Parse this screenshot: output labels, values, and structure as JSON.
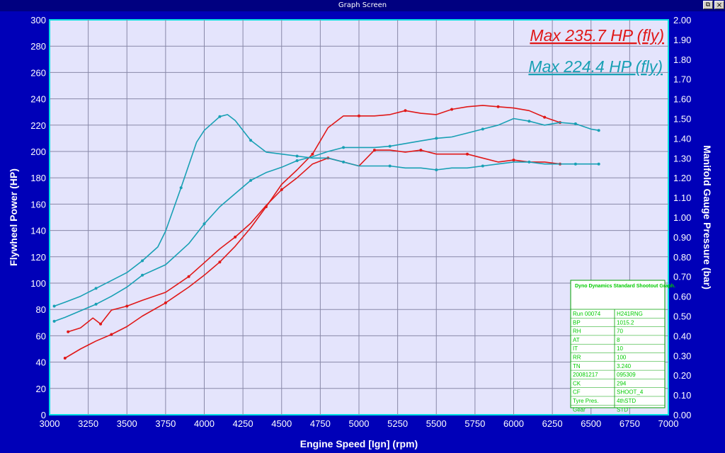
{
  "window": {
    "title": "Graph Screen",
    "restore_label": "⧉",
    "close_label": "×"
  },
  "annotations": {
    "max_red": "Max 235.7 HP (fly)",
    "max_teal": "Max 224.4 HP (fly)"
  },
  "colors": {
    "background": "#0000b8",
    "plot_bg": "#e4e4fc",
    "grid": "#8888a8",
    "axis": "#00e0e0",
    "red": "#e01818",
    "teal": "#18a0b4",
    "info_text": "#00cc00"
  },
  "info_box": {
    "title": "Dyno Dynamics Standard Shootout Graph.",
    "rows": [
      [
        "Run 00074",
        "H241RNG"
      ],
      [
        "BP",
        "1015.2"
      ],
      [
        "RH",
        "70"
      ],
      [
        "AT",
        "8"
      ],
      [
        "IT",
        "10"
      ],
      [
        "RR",
        "100"
      ],
      [
        "TN",
        "3.240"
      ],
      [
        "20081217",
        "095309"
      ],
      [
        "CK",
        "294"
      ],
      [
        "CF",
        "SHOOT_4"
      ],
      [
        "Tyre Pres.",
        "4thSTD"
      ],
      [
        "Gear",
        "STD"
      ]
    ]
  },
  "chart_data": {
    "type": "line",
    "xlabel": "Engine Speed [Ign] (rpm)",
    "ylabel": "Flywheel Power (HP)",
    "y2label": "Manifold Gauge Pressure (bar)",
    "xlim": [
      3000,
      7000
    ],
    "ylim": [
      0,
      300
    ],
    "y2lim": [
      0,
      2.0
    ],
    "xticks": [
      3000,
      3250,
      3500,
      3750,
      4000,
      4250,
      4500,
      4750,
      5000,
      5250,
      5500,
      5750,
      6000,
      6250,
      6500,
      6750,
      7000
    ],
    "yticks": [
      0,
      20,
      40,
      60,
      80,
      100,
      120,
      140,
      160,
      180,
      200,
      220,
      240,
      260,
      280,
      300
    ],
    "y2ticks": [
      "0.00",
      "0.10",
      "0.20",
      "0.30",
      "0.40",
      "0.50",
      "0.60",
      "0.70",
      "0.80",
      "0.90",
      "1.00",
      "1.10",
      "1.20",
      "1.30",
      "1.40",
      "1.50",
      "1.60",
      "1.70",
      "1.80",
      "1.90",
      "2.00"
    ],
    "grid": true,
    "series": [
      {
        "color": "#e01818",
        "axis": "left",
        "x": [
          3100,
          3200,
          3300,
          3400,
          3500,
          3600,
          3750,
          3900,
          4000,
          4100,
          4200,
          4300,
          4400,
          4500,
          4600,
          4700,
          4800,
          4900,
          5000,
          5100,
          5200,
          5300,
          5400,
          5500,
          5600,
          5700,
          5800,
          5900,
          6000,
          6100,
          6200,
          6300
        ],
        "y": [
          43,
          50,
          56,
          61,
          67,
          75,
          85,
          97,
          106,
          116,
          128,
          142,
          158,
          175,
          186,
          198,
          218,
          227,
          227,
          227,
          228,
          231,
          229,
          228,
          232,
          234,
          235,
          234,
          233,
          231,
          226,
          222
        ]
      },
      {
        "color": "#e01818",
        "axis": "right",
        "x": [
          3120,
          3200,
          3280,
          3330,
          3360,
          3400,
          3500,
          3600,
          3750,
          3900,
          4000,
          4100,
          4200,
          4300,
          4400,
          4500,
          4600,
          4700,
          4800,
          4900,
          5000,
          5100,
          5200,
          5300,
          5400,
          5500,
          5600,
          5700,
          5800,
          5900,
          6000,
          6100,
          6200,
          6300
        ],
        "y": [
          0.42,
          0.44,
          0.49,
          0.46,
          0.49,
          0.53,
          0.55,
          0.58,
          0.62,
          0.7,
          0.77,
          0.84,
          0.9,
          0.97,
          1.06,
          1.14,
          1.2,
          1.27,
          1.3,
          1.28,
          1.26,
          1.34,
          1.34,
          1.33,
          1.34,
          1.32,
          1.32,
          1.32,
          1.3,
          1.28,
          1.29,
          1.28,
          1.28,
          1.27
        ]
      },
      {
        "color": "#18a0b4",
        "axis": "left",
        "x": [
          3030,
          3100,
          3200,
          3300,
          3400,
          3500,
          3600,
          3750,
          3900,
          4000,
          4100,
          4200,
          4300,
          4400,
          4500,
          4600,
          4700,
          4800,
          4900,
          5000,
          5100,
          5200,
          5300,
          5400,
          5500,
          5600,
          5700,
          5800,
          5900,
          6000,
          6100,
          6200,
          6300,
          6400,
          6500,
          6550
        ],
        "y": [
          71,
          74,
          79,
          84,
          90,
          97,
          106,
          114,
          130,
          145,
          158,
          168,
          178,
          184,
          188,
          193,
          196,
          200,
          203,
          203,
          203,
          204,
          206,
          208,
          210,
          211,
          214,
          217,
          220,
          225,
          223,
          220,
          222,
          221,
          217,
          216
        ]
      },
      {
        "color": "#18a0b4",
        "axis": "right",
        "x": [
          3030,
          3100,
          3200,
          3300,
          3400,
          3500,
          3600,
          3700,
          3750,
          3850,
          3950,
          4000,
          4100,
          4150,
          4200,
          4300,
          4400,
          4500,
          4600,
          4700,
          4800,
          4900,
          5000,
          5100,
          5200,
          5300,
          5400,
          5500,
          5600,
          5700,
          5800,
          5900,
          6000,
          6100,
          6200,
          6300,
          6400,
          6550
        ],
        "y": [
          0.55,
          0.57,
          0.6,
          0.64,
          0.68,
          0.72,
          0.78,
          0.85,
          0.93,
          1.15,
          1.38,
          1.44,
          1.51,
          1.52,
          1.49,
          1.39,
          1.33,
          1.32,
          1.31,
          1.3,
          1.3,
          1.28,
          1.26,
          1.26,
          1.26,
          1.25,
          1.25,
          1.24,
          1.25,
          1.25,
          1.26,
          1.27,
          1.28,
          1.28,
          1.27,
          1.27,
          1.27,
          1.27
        ]
      }
    ]
  }
}
